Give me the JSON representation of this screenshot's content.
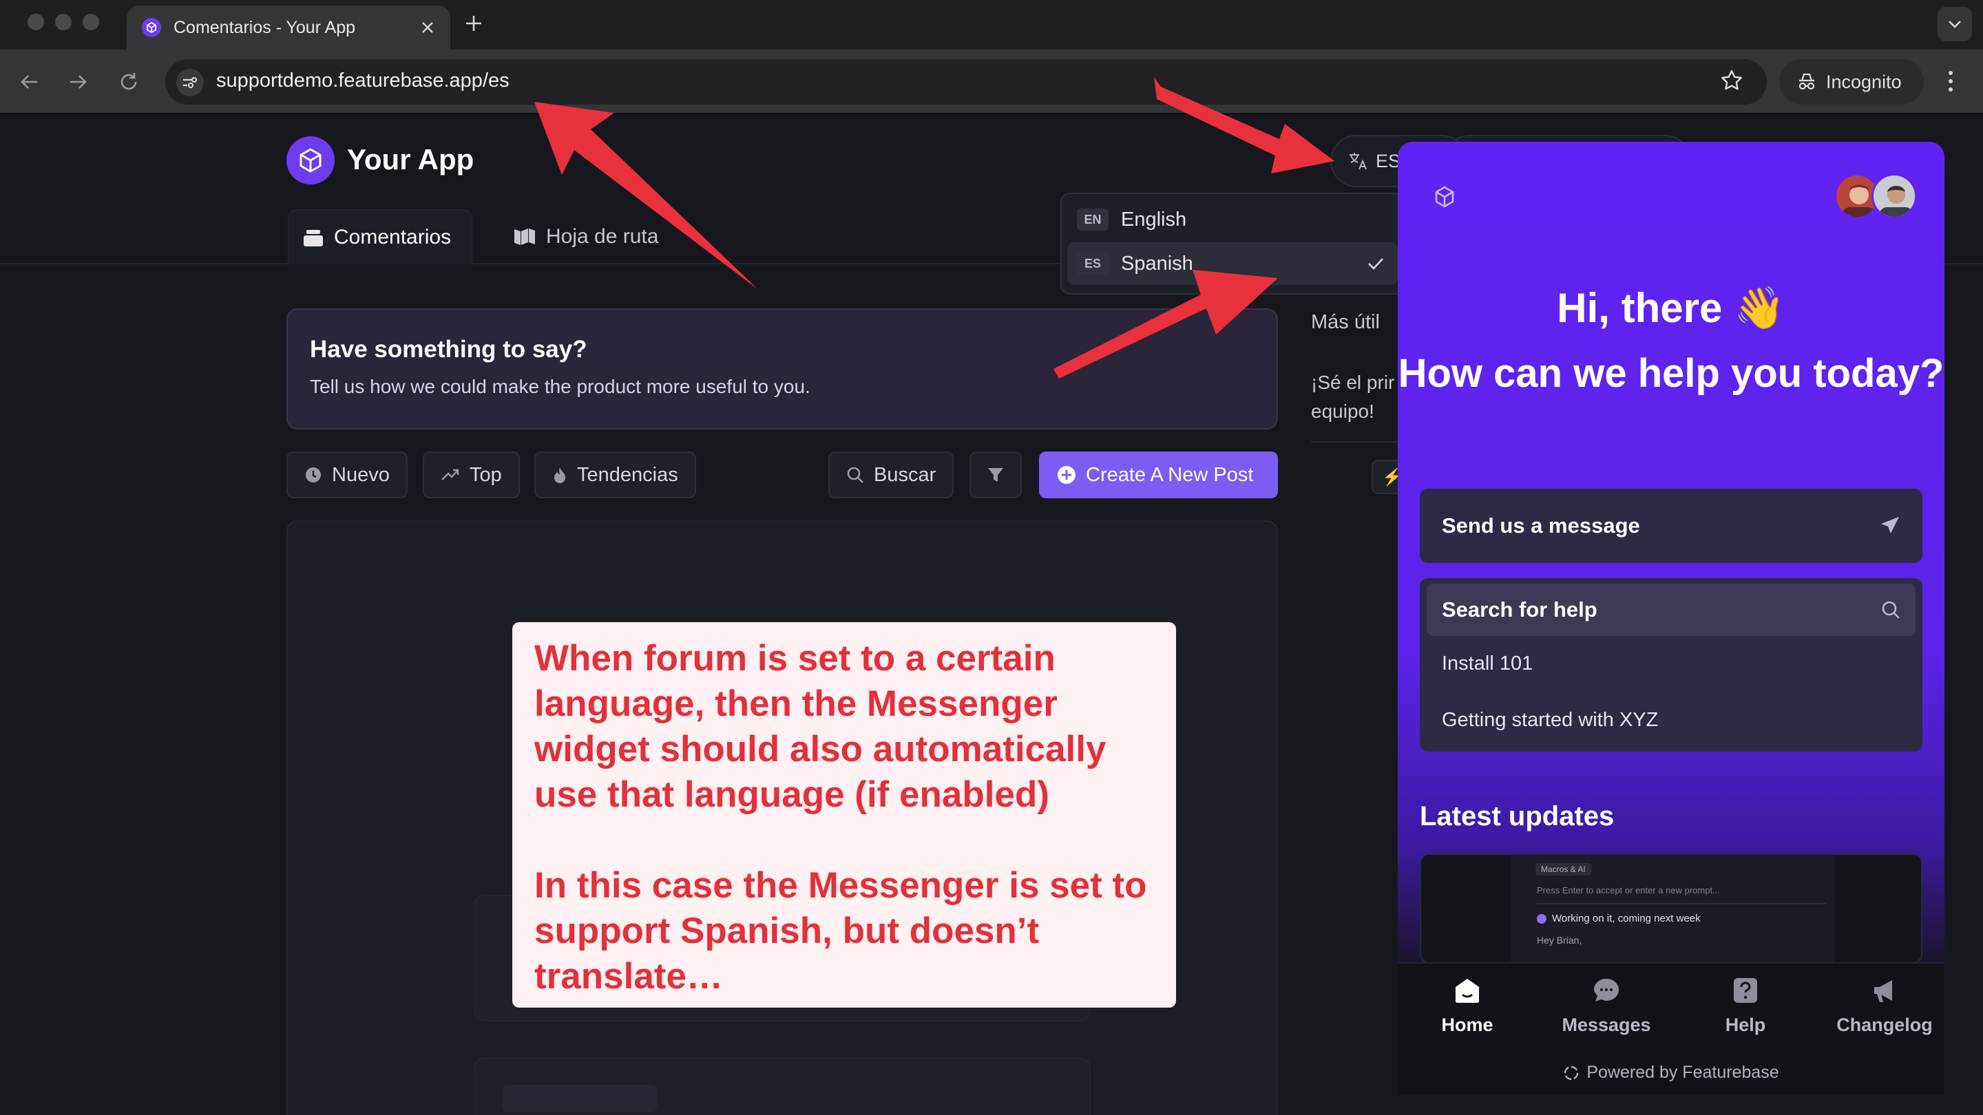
{
  "browser": {
    "tab_title": "Comentarios - Your App",
    "url": "supportdemo.featurebase.app/es",
    "incognito_label": "Incognito"
  },
  "site": {
    "brand": "Your App",
    "tabs": [
      {
        "label": "Comentarios"
      },
      {
        "label": "Hoja de ruta"
      }
    ],
    "banner": {
      "title": "Have something to say?",
      "subtitle": "Tell us how we could make the product more useful to you."
    },
    "filters": {
      "nuevo": "Nuevo",
      "top": "Top",
      "tendencias": "Tendencias",
      "buscar": "Buscar",
      "create": "Create A New Post"
    },
    "sidebar": {
      "label": "Más útil",
      "text_line1": "¡Sé el prir",
      "text_line2": "equipo!"
    },
    "language": {
      "current": "ES",
      "options": [
        {
          "code": "EN",
          "label": "English"
        },
        {
          "code": "ES",
          "label": "Spanish"
        }
      ]
    }
  },
  "messenger": {
    "greeting": "Hi, there 👋",
    "question": "How can we help you today?",
    "send_message": "Send us a message",
    "search_help": "Search for help",
    "articles": [
      "Install 101",
      "Getting started with XYZ"
    ],
    "latest_updates": "Latest updates",
    "update_preview": {
      "tag": "Macros & AI",
      "input_hint": "Press Enter to accept or enter a new prompt...",
      "status": "Working on it, coming next week",
      "reply": "Hey Brian,"
    },
    "nav": [
      {
        "label": "Home"
      },
      {
        "label": "Messages"
      },
      {
        "label": "Help"
      },
      {
        "label": "Changelog"
      }
    ],
    "powered_by": "Powered by Featurebase"
  },
  "annotation": {
    "paragraph1": "When forum is set to a certain language, then the Messenger widget should also automatically use that language (if enabled)",
    "paragraph2": "In this case the Messenger is set to support Spanish, but doesn’t translate…"
  },
  "colors": {
    "accent": "#7c5cf2",
    "widget_purple": "#6123f2",
    "annotation_red": "#e0313c"
  }
}
